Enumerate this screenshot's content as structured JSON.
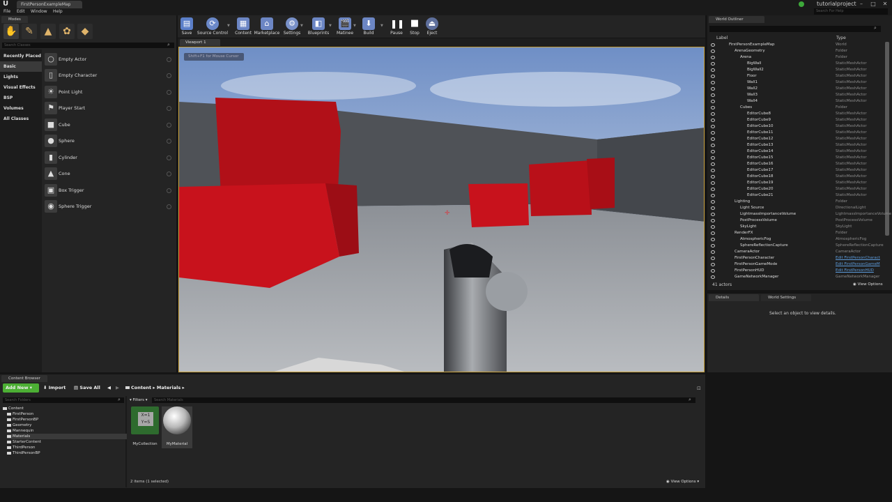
{
  "app": {
    "doc_tab": "FirstPersonExampleMap",
    "project": "tutorialproject",
    "search_help_placeholder": "Search For Help",
    "menu": [
      "File",
      "Edit",
      "Window",
      "Help"
    ]
  },
  "modes": {
    "tab": "Modes",
    "search_placeholder": "Search Classes",
    "categories": [
      "Recently Placed",
      "Basic",
      "Lights",
      "Visual Effects",
      "BSP",
      "Volumes",
      "All Classes"
    ],
    "items": [
      "Empty Actor",
      "Empty Character",
      "Point Light",
      "Player Start",
      "Cube",
      "Sphere",
      "Cylinder",
      "Cone",
      "Box Trigger",
      "Sphere Trigger"
    ]
  },
  "toolbar": {
    "buttons": [
      "Save",
      "Source Control",
      "Content",
      "Marketplace",
      "Settings",
      "Blueprints",
      "Matinee",
      "Build",
      "Pause",
      "Stop",
      "Eject"
    ]
  },
  "viewport": {
    "tab": "Viewport 1",
    "hint": "Shift+F1 for Mouse Cursor"
  },
  "outliner": {
    "tab": "World Outliner",
    "col_label": "Label",
    "col_type": "Type",
    "rows": [
      {
        "label": "FirstPersonExampleMap",
        "type": "World"
      },
      {
        "label": "ArenaGeometry",
        "type": "Folder"
      },
      {
        "label": "Arena",
        "type": "Folder"
      },
      {
        "label": "BigWall",
        "type": "StaticMeshActor"
      },
      {
        "label": "BigWall2",
        "type": "StaticMeshActor"
      },
      {
        "label": "Floor",
        "type": "StaticMeshActor"
      },
      {
        "label": "Wall1",
        "type": "StaticMeshActor"
      },
      {
        "label": "Wall2",
        "type": "StaticMeshActor"
      },
      {
        "label": "Wall3",
        "type": "StaticMeshActor"
      },
      {
        "label": "Wall4",
        "type": "StaticMeshActor"
      },
      {
        "label": "Cubes",
        "type": "Folder"
      },
      {
        "label": "EditorCube8",
        "type": "StaticMeshActor"
      },
      {
        "label": "EditorCube9",
        "type": "StaticMeshActor"
      },
      {
        "label": "EditorCube10",
        "type": "StaticMeshActor"
      },
      {
        "label": "EditorCube11",
        "type": "StaticMeshActor"
      },
      {
        "label": "EditorCube12",
        "type": "StaticMeshActor"
      },
      {
        "label": "EditorCube13",
        "type": "StaticMeshActor"
      },
      {
        "label": "EditorCube14",
        "type": "StaticMeshActor"
      },
      {
        "label": "EditorCube15",
        "type": "StaticMeshActor"
      },
      {
        "label": "EditorCube16",
        "type": "StaticMeshActor"
      },
      {
        "label": "EditorCube17",
        "type": "StaticMeshActor"
      },
      {
        "label": "EditorCube18",
        "type": "StaticMeshActor"
      },
      {
        "label": "EditorCube19",
        "type": "StaticMeshActor"
      },
      {
        "label": "EditorCube20",
        "type": "StaticMeshActor"
      },
      {
        "label": "EditorCube21",
        "type": "StaticMeshActor"
      },
      {
        "label": "Lighting",
        "type": "Folder"
      },
      {
        "label": "Light Source",
        "type": "DirectionalLight"
      },
      {
        "label": "LightmassImportanceVolume",
        "type": "LightmassImportanceVolume"
      },
      {
        "label": "PostProcessVolume",
        "type": "PostProcessVolume"
      },
      {
        "label": "SkyLight",
        "type": "SkyLight"
      },
      {
        "label": "RenderFX",
        "type": "Folder"
      },
      {
        "label": "AtmosphericFog",
        "type": "AtmosphericFog"
      },
      {
        "label": "SphereReflectionCapture",
        "type": "SphereReflectionCapture"
      },
      {
        "label": "CameraActor",
        "type": "CameraActor"
      },
      {
        "label": "FirstPersonCharacter",
        "type": "Edit FirstPersonCharact"
      },
      {
        "label": "FirstPersonGameMode",
        "type": "Edit FirstPersonGameM"
      },
      {
        "label": "FirstPersonHUD",
        "type": "Edit FirstPersonHUD"
      },
      {
        "label": "GameNetworkManager",
        "type": "GameNetworkManager"
      }
    ],
    "count": "41 actors",
    "view_options": "View Options"
  },
  "details": {
    "tab_details": "Details",
    "tab_world": "World Settings",
    "empty_msg": "Select an object to view details."
  },
  "content_browser": {
    "tab": "Content Browser",
    "add_new": "Add New",
    "import": "Import",
    "save_all": "Save All",
    "path": [
      "Content",
      "Materials"
    ],
    "folder_search_placeholder": "Search Folders",
    "filters": "Filters",
    "asset_search_placeholder": "Search Materials",
    "tree": [
      "Content",
      "FirstPerson",
      "FirstPersonBP",
      "Geometry",
      "Mannequin",
      "Materials",
      "StarterContent",
      "ThirdPerson",
      "ThirdPersonBP"
    ],
    "assets": [
      "MyCollection",
      "MyMaterial"
    ],
    "status": "2 items (1 selected)",
    "view_options": "View Options"
  },
  "colors": {
    "accent": "#c9a13a",
    "cube_red": "#c8121c",
    "link": "#5c9bdb",
    "add_new_green": "#4caf34"
  }
}
